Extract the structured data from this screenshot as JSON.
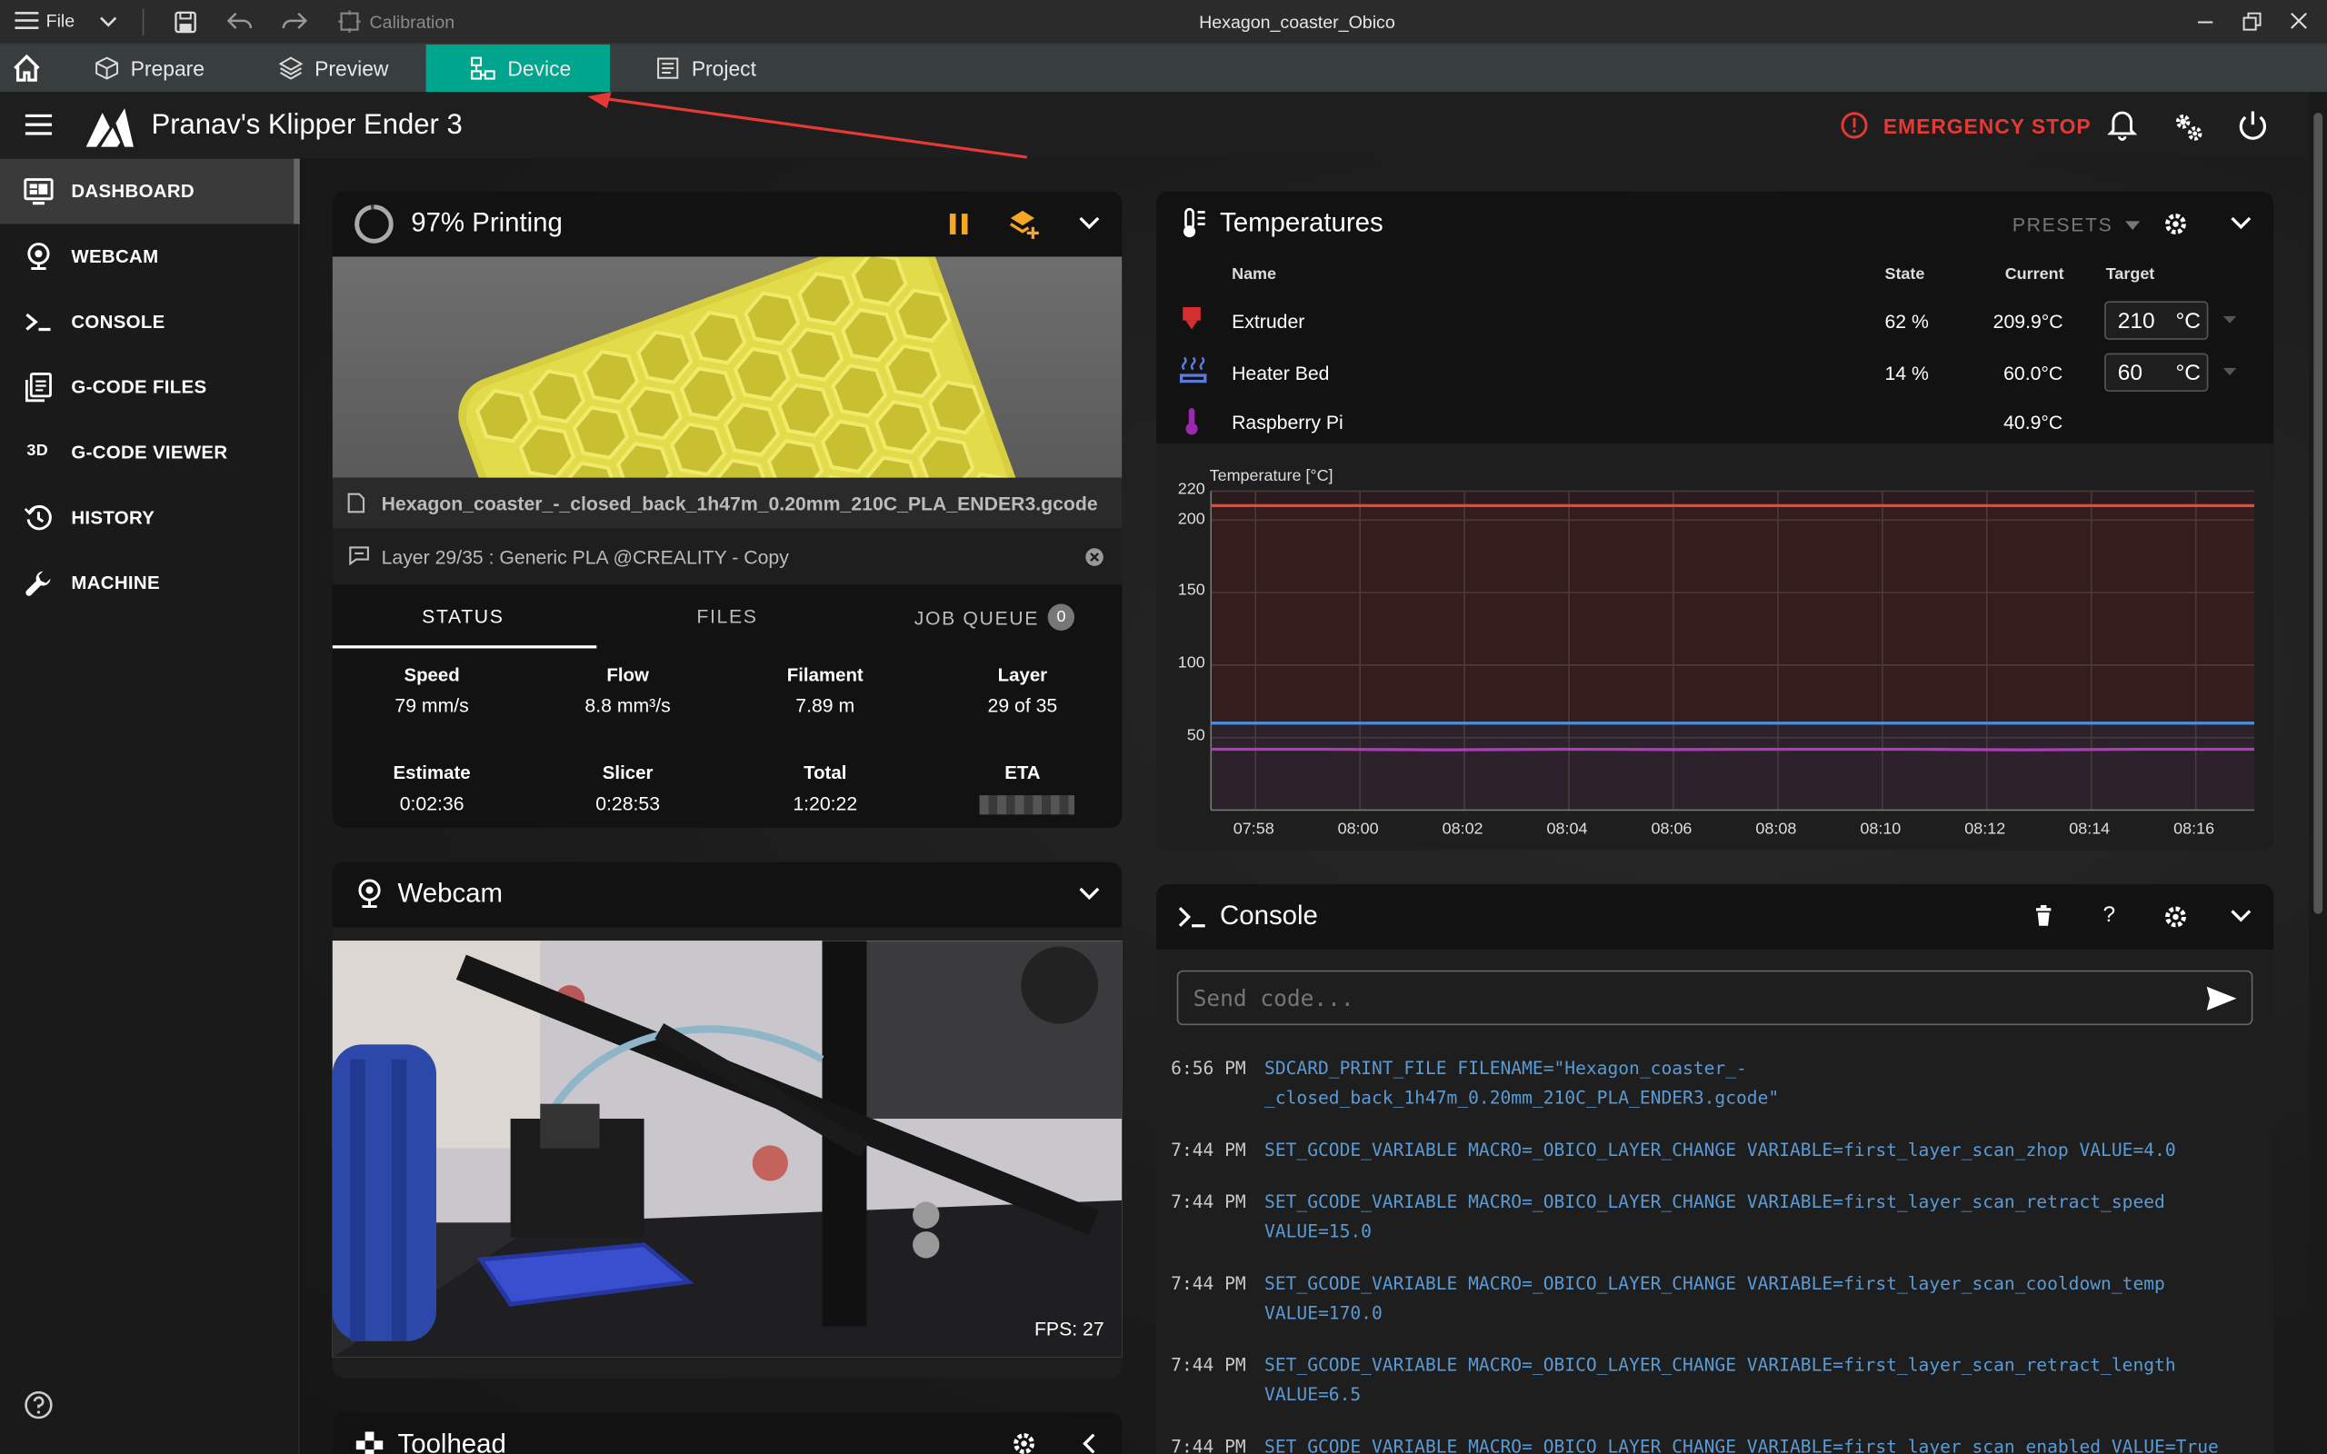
{
  "window": {
    "title": "Hexagon_coaster_Obico",
    "file_menu": "File",
    "calibration": "Calibration"
  },
  "tabs": [
    {
      "label": "Prepare"
    },
    {
      "label": "Preview"
    },
    {
      "label": "Device",
      "active": true
    },
    {
      "label": "Project"
    }
  ],
  "header": {
    "printer_name": "Pranav's Klipper Ender 3",
    "emergency_stop": "EMERGENCY STOP"
  },
  "sidebar": {
    "items": [
      {
        "label": "DASHBOARD",
        "icon": "monitor-dashboard-icon",
        "active": true
      },
      {
        "label": "WEBCAM",
        "icon": "webcam-icon"
      },
      {
        "label": "CONSOLE",
        "icon": "console-icon"
      },
      {
        "label": "G-CODE FILES",
        "icon": "file-document-icon"
      },
      {
        "label": "G-CODE VIEWER",
        "icon": "3d-icon"
      },
      {
        "label": "HISTORY",
        "icon": "history-icon"
      },
      {
        "label": "MACHINE",
        "icon": "wrench-icon"
      }
    ]
  },
  "status_panel": {
    "title": "97% Printing",
    "progress": 0.97,
    "filename": "Hexagon_coaster_-_closed_back_1h47m_0.20mm_210C_PLA_ENDER3.gcode",
    "layer_message": "Layer 29/35 : Generic PLA @CREALITY - Copy",
    "tabs": [
      "STATUS",
      "FILES",
      "JOB QUEUE"
    ],
    "job_queue_count": "0",
    "stats_row1": [
      {
        "label": "Speed",
        "value": "79 mm/s"
      },
      {
        "label": "Flow",
        "value": "8.8 mm³/s"
      },
      {
        "label": "Filament",
        "value": "7.89 m"
      },
      {
        "label": "Layer",
        "value": "29 of 35"
      }
    ],
    "stats_row2": [
      {
        "label": "Estimate",
        "value": "0:02:36"
      },
      {
        "label": "Slicer",
        "value": "0:28:53"
      },
      {
        "label": "Total",
        "value": "1:20:22"
      },
      {
        "label": "ETA",
        "value": ""
      }
    ]
  },
  "webcam_panel": {
    "title": "Webcam",
    "fps": "FPS: 27"
  },
  "toolhead_panel": {
    "title": "Toolhead"
  },
  "temperatures": {
    "title": "Temperatures",
    "presets": "PRESETS",
    "columns": {
      "name": "Name",
      "state": "State",
      "current": "Current",
      "target": "Target"
    },
    "rows": [
      {
        "name": "Extruder",
        "state": "62 %",
        "current": "209.9°C",
        "target": "210",
        "unit": "°C",
        "color": "#d32f2f"
      },
      {
        "name": "Heater Bed",
        "state": "14 %",
        "current": "60.0°C",
        "target": "60",
        "unit": "°C",
        "color": "#5c7bd8"
      },
      {
        "name": "Raspberry Pi",
        "state": "",
        "current": "40.9°C",
        "target": "",
        "unit": "",
        "color": "#9c27b0"
      }
    ]
  },
  "chart_data": {
    "type": "line",
    "title": "",
    "ylabel": "Temperature [°C]",
    "ylim": [
      0,
      220
    ],
    "y_ticks": [
      50,
      100,
      150,
      200,
      220
    ],
    "x_ticks": [
      "07:58",
      "08:00",
      "08:02",
      "08:04",
      "08:06",
      "08:08",
      "08:10",
      "08:12",
      "08:14",
      "08:16"
    ],
    "series": [
      {
        "name": "Extruder",
        "color": "#f44336",
        "values": [
          210,
          210,
          210,
          210,
          210,
          210,
          210,
          210,
          210,
          210
        ]
      },
      {
        "name": "Heater Bed",
        "color": "#4a90e2",
        "values": [
          60,
          60,
          60,
          60,
          60,
          60,
          60,
          60,
          60,
          60
        ]
      },
      {
        "name": "Raspberry Pi",
        "color": "#b03ab8",
        "values": [
          42,
          42,
          41.5,
          42,
          41.8,
          42,
          42,
          41.5,
          42,
          42
        ]
      }
    ],
    "grid": true
  },
  "console": {
    "title": "Console",
    "placeholder": "Send code...",
    "lines": [
      {
        "time": "6:56 PM",
        "text": "SDCARD_PRINT_FILE FILENAME=\"Hexagon_coaster_-_closed_back_1h47m_0.20mm_210C_PLA_ENDER3.gcode\"",
        "l1": "SDCARD_PRINT_FILE FILENAME=\"Hexagon_coaster_-",
        "l2": "_closed_back_1h47m_0.20mm_210C_PLA_ENDER3.gcode\""
      },
      {
        "time": "7:44 PM",
        "l1": "SET_GCODE_VARIABLE MACRO=_OBICO_LAYER_CHANGE VARIABLE=first_layer_scan_zhop VALUE=4.0",
        "l2": ""
      },
      {
        "time": "7:44 PM",
        "l1": "SET_GCODE_VARIABLE MACRO=_OBICO_LAYER_CHANGE VARIABLE=first_layer_scan_retract_speed",
        "l2": "VALUE=15.0"
      },
      {
        "time": "7:44 PM",
        "l1": "SET_GCODE_VARIABLE MACRO=_OBICO_LAYER_CHANGE VARIABLE=first_layer_scan_cooldown_temp",
        "l2": "VALUE=170.0"
      },
      {
        "time": "7:44 PM",
        "l1": "SET_GCODE_VARIABLE MACRO=_OBICO_LAYER_CHANGE VARIABLE=first_layer_scan_retract_length",
        "l2": "VALUE=6.5"
      },
      {
        "time": "7:44 PM",
        "l1": "SET_GCODE_VARIABLE MACRO=_OBICO_LAYER_CHANGE VARIABLE=first_layer_scan_enabled VALUE=True",
        "l2": ""
      }
    ]
  },
  "colors": {
    "accent": "#00a58e",
    "emergency": "#e53935",
    "warning": "#f5a623",
    "console_text": "#5b9bd5"
  }
}
